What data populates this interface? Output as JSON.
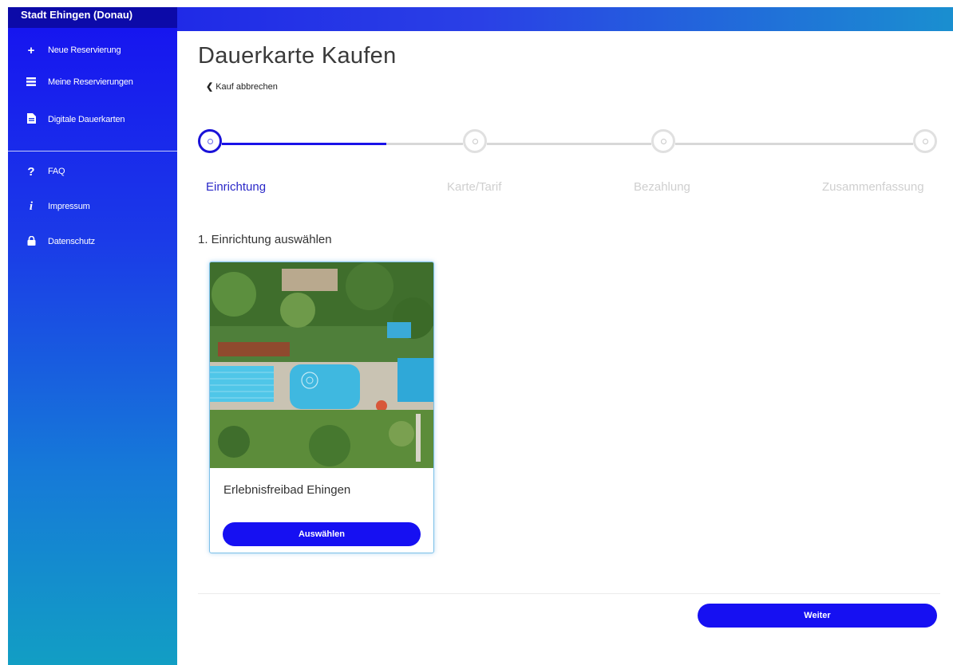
{
  "brand": "Stadt Ehingen (Donau)",
  "sidebar": {
    "items": [
      {
        "label": "Neue Reservierung",
        "icon": "plus-icon"
      },
      {
        "label": "Meine Reservierungen",
        "icon": "list-icon"
      },
      {
        "label": "Digitale Dauerkarten",
        "icon": "file-icon"
      }
    ],
    "secondary": [
      {
        "label": "FAQ",
        "icon": "question-icon"
      },
      {
        "label": "Impressum",
        "icon": "info-icon"
      },
      {
        "label": "Datenschutz",
        "icon": "lock-icon"
      }
    ]
  },
  "page": {
    "title": "Dauerkarte Kaufen",
    "back_label": "Kauf abbrechen"
  },
  "stepper": {
    "current": 1,
    "steps": [
      "Einrichtung",
      "Karte/Tarif",
      "Bezahlung",
      "Zusammenfassung"
    ]
  },
  "section": {
    "title": "1. Einrichtung auswählen"
  },
  "facility": {
    "name": "Erlebnisfreibad Ehingen",
    "select_label": "Auswählen"
  },
  "footer": {
    "next_label": "Weiter"
  },
  "colors": {
    "accent": "#1610f2",
    "sidebar_top": "#1612f0",
    "sidebar_bottom": "#129ec4",
    "step_active_text": "#2a28c8"
  }
}
